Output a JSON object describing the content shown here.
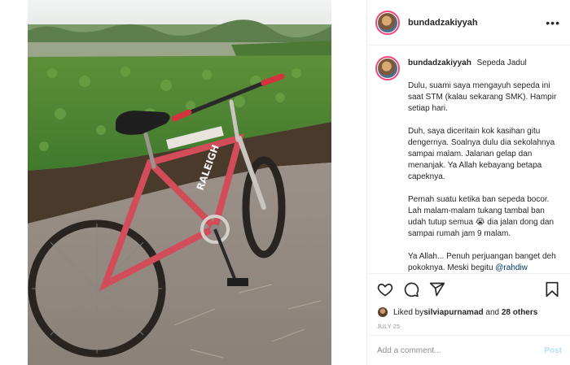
{
  "header": {
    "username": "bundadzakiyyah",
    "more_glyph": "•••"
  },
  "caption": {
    "username": "bundadzakiyyah",
    "title": "Sepeda Jadul",
    "paragraphs": [
      "Dulu, suami saya mengayuh sepeda ini saat STM (kalau sekarang SMK). Hampir setiap hari.",
      "Duh, saya diceritain kok kasihan gitu dengernya. Soalnya dulu dia sekolahnya sampai malam. Jalanan gelap dan menanjak. Ya Allah kebayang betapa capeknya.",
      "Pernah suatu ketika ban sepeda bocor. Lah malam-malam tukang tambal ban udah tutup semua 😭 dia jalan dong dan sampai rumah jam 9 malam."
    ],
    "last_text": "Ya Allah... Penuh perjuangan banget deh pokoknya. Meski begitu ",
    "last_mention": "@rahdiw"
  },
  "actions": {
    "icons": [
      "heart-icon",
      "comment-icon",
      "share-icon",
      "bookmark-icon"
    ]
  },
  "likes": {
    "prefix": "Liked by ",
    "user": "silviapurnamad",
    "middle": " and ",
    "others": "28 others"
  },
  "post_date": "JULY 25",
  "comment_box": {
    "placeholder": "Add a comment...",
    "post_label": "Post"
  },
  "colors": {
    "avatar_ring": "#e84a7c",
    "post_button_disabled": "#b2dffc",
    "mention": "#00376b",
    "muted_text": "#8e8e8e"
  }
}
